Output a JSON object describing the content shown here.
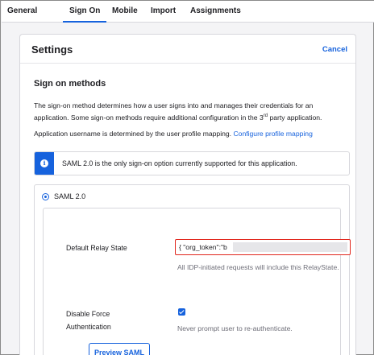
{
  "tabs": [
    {
      "label": "General",
      "active": false
    },
    {
      "label": "Sign On",
      "active": true
    },
    {
      "label": "Mobile",
      "active": false
    },
    {
      "label": "Import",
      "active": false
    },
    {
      "label": "Assignments",
      "active": false
    }
  ],
  "settings": {
    "title": "Settings",
    "cancel_label": "Cancel",
    "section_title": "Sign on methods",
    "description_line1": "The sign-on method determines how a user signs into and manages their credentials for an",
    "description_line2_before": "application. Some sign-on methods require additional configuration in the 3",
    "description_line2_sup": "rd",
    "description_line2_after": " party application.",
    "username_text": "Application username is determined by the user profile mapping. ",
    "configure_mapping_link": "Configure profile mapping",
    "info_message": "SAML 2.0 is the only sign-on option currently supported for this application.",
    "info_icon": "info-icon",
    "accent_color": "#1662dd"
  },
  "saml": {
    "option_label": "SAML 2.0",
    "selected": true,
    "relay_state_label": "Default Relay State",
    "relay_state_value": "{ \"org_token\":\"b",
    "relay_state_hint": "All IDP-initiated requests will include this RelayState.",
    "force_auth_label_line1": "Disable Force",
    "force_auth_label_line2": "Authentication",
    "force_auth_checked": true,
    "force_auth_hint": "Never prompt user to re-authenticate.",
    "preview_button_label": "Preview SAML"
  }
}
